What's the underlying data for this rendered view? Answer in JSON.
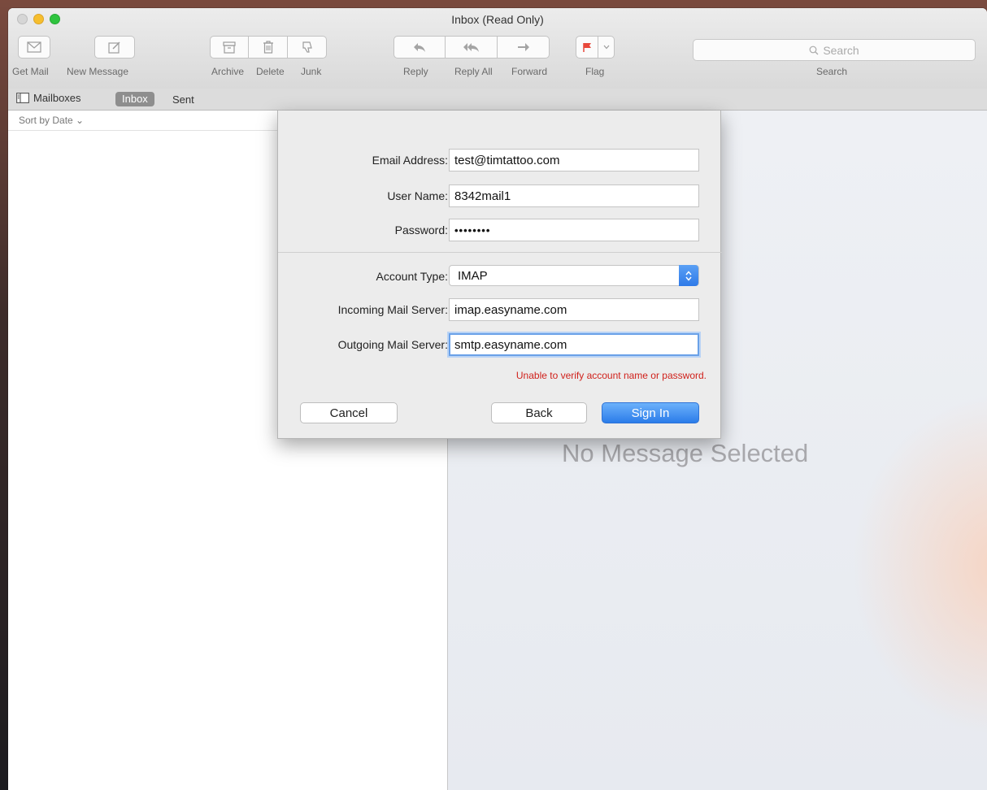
{
  "window": {
    "title": "Inbox (Read Only)"
  },
  "toolbar": {
    "get_mail": "Get Mail",
    "new_message": "New Message",
    "archive": "Archive",
    "delete": "Delete",
    "junk": "Junk",
    "reply": "Reply",
    "reply_all": "Reply All",
    "forward": "Forward",
    "flag": "Flag",
    "search_placeholder": "Search",
    "search_label": "Search"
  },
  "favorites": {
    "mailboxes": "Mailboxes",
    "inbox": "Inbox",
    "sent": "Sent"
  },
  "list": {
    "sort": "Sort by Date ⌄"
  },
  "viewer": {
    "empty": "No Message Selected"
  },
  "sheet": {
    "email_label": "Email Address:",
    "email_value": "test@timtattoo.com",
    "username_label": "User Name:",
    "username_value": "8342mail1",
    "password_label": "Password:",
    "password_value": "••••••••",
    "account_type_label": "Account Type:",
    "account_type_value": "IMAP",
    "incoming_label": "Incoming Mail Server:",
    "incoming_value": "imap.easyname.com",
    "outgoing_label": "Outgoing Mail Server:",
    "outgoing_value": "smtp.easyname.com",
    "error": "Unable to verify account name or password.",
    "cancel": "Cancel",
    "back": "Back",
    "sign_in": "Sign In"
  },
  "colors": {
    "accent": "#2b7ce9",
    "error": "#d0211b",
    "flag": "#e8483b"
  }
}
